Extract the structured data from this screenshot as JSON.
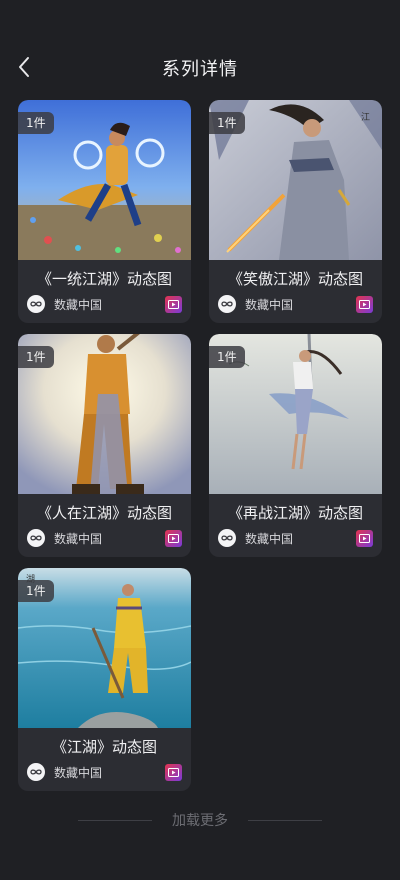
{
  "header": {
    "title": "系列详情",
    "back_icon": "chevron-left-icon"
  },
  "cards": [
    {
      "title": "《一统江湖》动态图",
      "count": "1件",
      "publisher": "数藏中国"
    },
    {
      "title": "《笑傲江湖》动态图",
      "count": "1件",
      "publisher": "数藏中国"
    },
    {
      "title": "《人在江湖》动态图",
      "count": "1件",
      "publisher": "数藏中国"
    },
    {
      "title": "《再战江湖》动态图",
      "count": "1件",
      "publisher": "数藏中国"
    },
    {
      "title": "《江湖》动态图",
      "count": "1件",
      "publisher": "数藏中国"
    }
  ],
  "footer": {
    "load_more": "加载更多"
  },
  "colors": {
    "background": "#1f2024",
    "card": "#2c2d33",
    "accent": "#e2344f"
  }
}
